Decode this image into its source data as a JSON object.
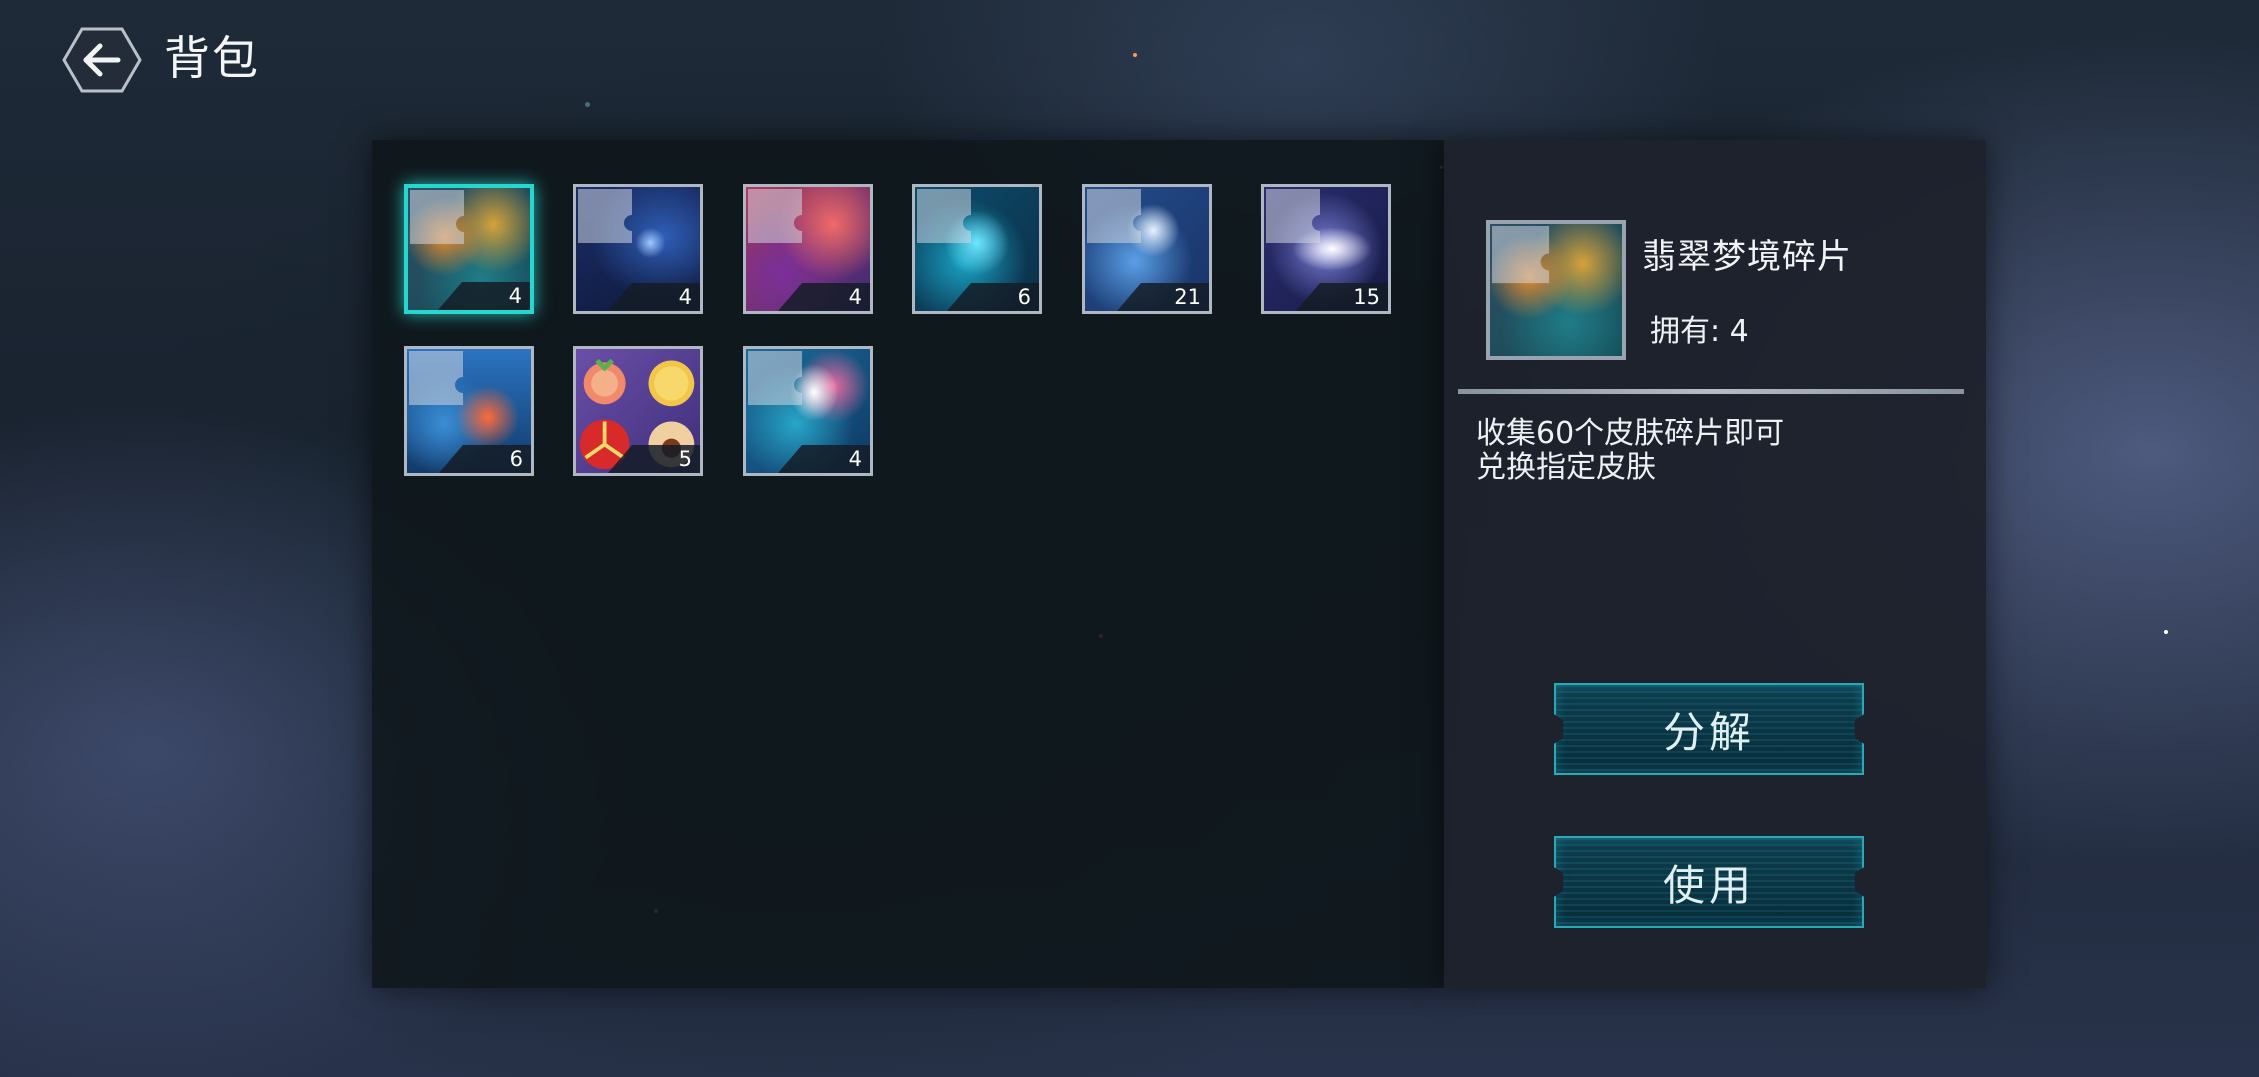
{
  "header": {
    "title": "背包",
    "back_icon": "back-arrow-icon"
  },
  "inventory": {
    "items": [
      {
        "name": "翡翠梦境碎片",
        "count": "4",
        "selected": true
      },
      {
        "count": "4"
      },
      {
        "count": "4"
      },
      {
        "count": "6"
      },
      {
        "count": "21"
      },
      {
        "count": "15"
      },
      {
        "count": "6"
      },
      {
        "count": "5"
      },
      {
        "count": "4"
      }
    ]
  },
  "detail": {
    "name": "翡翠梦境碎片",
    "own_label": "拥有: 4",
    "description": "收集60个皮肤碎片即可\n兑换指定皮肤",
    "decompose_label": "分解",
    "use_label": "使用"
  },
  "colors": {
    "accent": "#27d7cf",
    "button_border": "#28a9b8"
  }
}
